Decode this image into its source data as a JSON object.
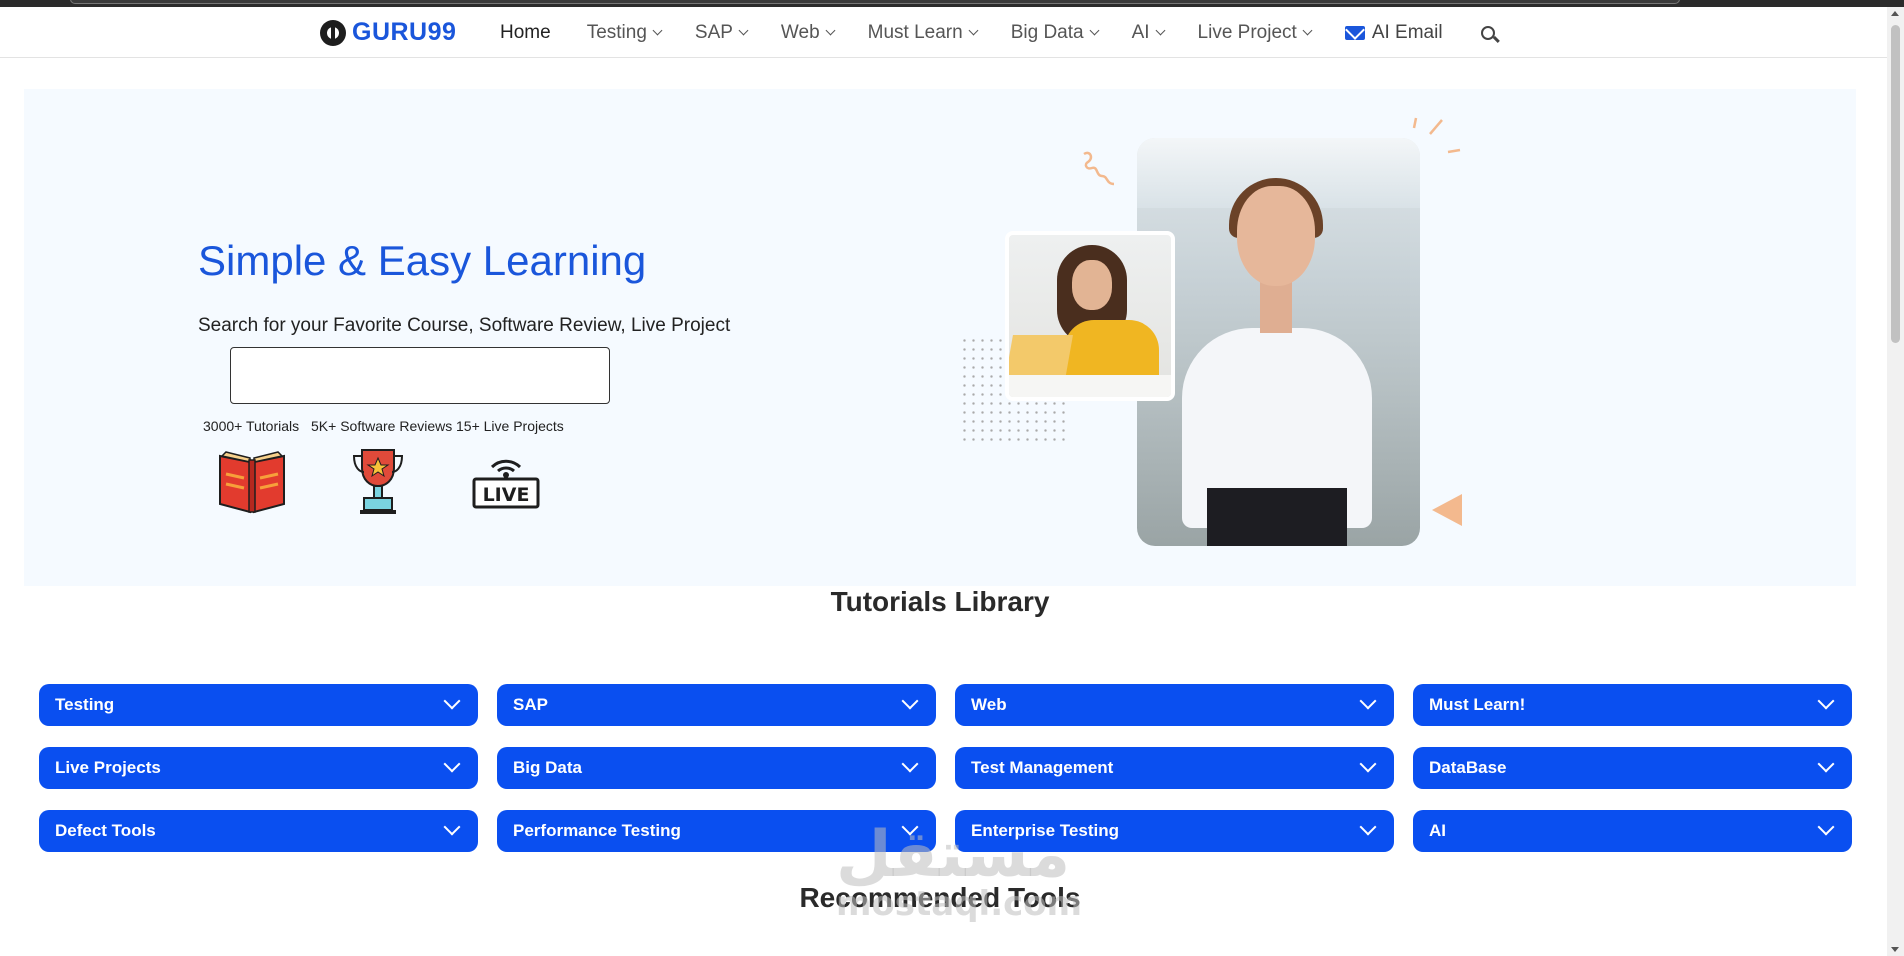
{
  "brand": {
    "logo_text": "GURU99",
    "accent_color": "#1a56db",
    "button_color": "#0a4ff0"
  },
  "nav": {
    "items": [
      {
        "label": "Home",
        "has_dropdown": false
      },
      {
        "label": "Testing",
        "has_dropdown": true
      },
      {
        "label": "SAP",
        "has_dropdown": true
      },
      {
        "label": "Web",
        "has_dropdown": true
      },
      {
        "label": "Must Learn",
        "has_dropdown": true
      },
      {
        "label": "Big Data",
        "has_dropdown": true
      },
      {
        "label": "AI",
        "has_dropdown": true
      },
      {
        "label": "Live Project",
        "has_dropdown": true
      }
    ],
    "email_label": "AI Email",
    "email_icon": "envelope-icon",
    "search_icon": "search-icon"
  },
  "hero": {
    "title": "Simple & Easy Learning",
    "subtitle": "Search for your Favorite Course, Software Review, Live Project",
    "search": {
      "value": "",
      "placeholder": ""
    },
    "stats": [
      {
        "label": "3000+ Tutorials",
        "icon": "book-icon"
      },
      {
        "label": "5K+ Software Reviews",
        "icon": "trophy-icon"
      },
      {
        "label": "15+ Live Projects",
        "icon": "live-icon"
      }
    ],
    "live_badge_text": "LIVE"
  },
  "library": {
    "title": "Tutorials Library",
    "categories": [
      "Testing",
      "SAP",
      "Web",
      "Must Learn!",
      "Live Projects",
      "Big Data",
      "Test Management",
      "DataBase",
      "Defect Tools",
      "Performance Testing",
      "Enterprise Testing",
      "AI"
    ]
  },
  "recommended": {
    "title": "Recommended Tools"
  },
  "watermark": {
    "arabic": "مستقل",
    "latin": "mostaql.com"
  }
}
